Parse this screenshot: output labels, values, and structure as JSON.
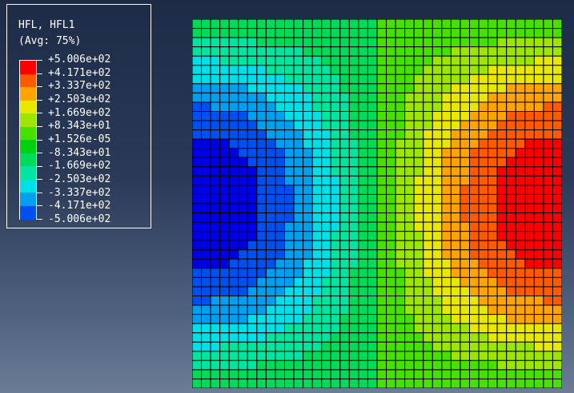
{
  "legend": {
    "title": "HFL, HFL1",
    "subtitle": "(Avg: 75%)",
    "labels": [
      "+5.006e+02",
      "+4.171e+02",
      "+3.337e+02",
      "+2.503e+02",
      "+1.669e+02",
      "+8.343e+01",
      "+1.526e-05",
      "-8.343e+01",
      "-1.669e+02",
      "-2.503e+02",
      "-3.337e+02",
      "-4.171e+02",
      "-5.006e+02"
    ],
    "colors": [
      "#ff0000",
      "#ff5a00",
      "#ffa400",
      "#e8e800",
      "#9ce600",
      "#46e100",
      "#00d210",
      "#00dc5a",
      "#00e6a0",
      "#00e0e8",
      "#00a0f0",
      "#0050f0",
      "#0000e6"
    ]
  }
}
